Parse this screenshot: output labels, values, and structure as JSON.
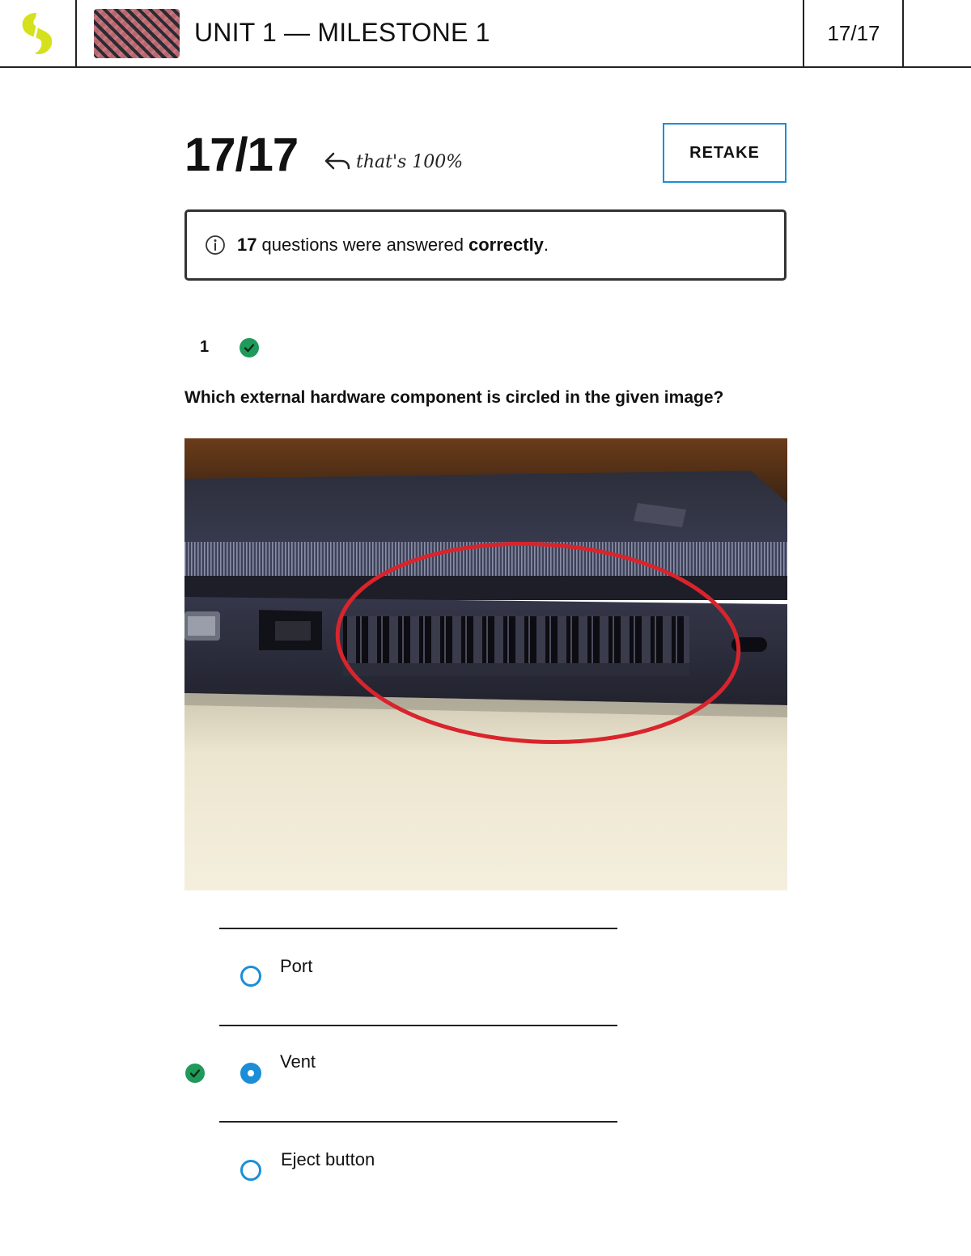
{
  "header": {
    "title": "UNIT 1 — MILESTONE 1",
    "score": "17/17"
  },
  "results": {
    "score": "17/17",
    "note": "that's 100%",
    "retake_label": "RETAKE",
    "summary": {
      "count": "17",
      "text": "questions were answered",
      "emphasis": "correctly",
      "period": "."
    }
  },
  "question": {
    "number": "1",
    "status": "correct",
    "text": "Which external hardware component is circled in the given image?",
    "answers": [
      {
        "label": "Port",
        "selected": false
      },
      {
        "label": "Vent",
        "selected": true,
        "correct": true
      },
      {
        "label": "Eject button",
        "selected": false
      }
    ]
  },
  "colors": {
    "accent": "#1c8ed8",
    "success": "#1f9a5b",
    "logo": "#d4e11c",
    "highlight_circle": "#d9242c"
  },
  "icons": [
    "logo-icon",
    "undo-arrow-icon",
    "info-icon",
    "check-circle-icon"
  ]
}
